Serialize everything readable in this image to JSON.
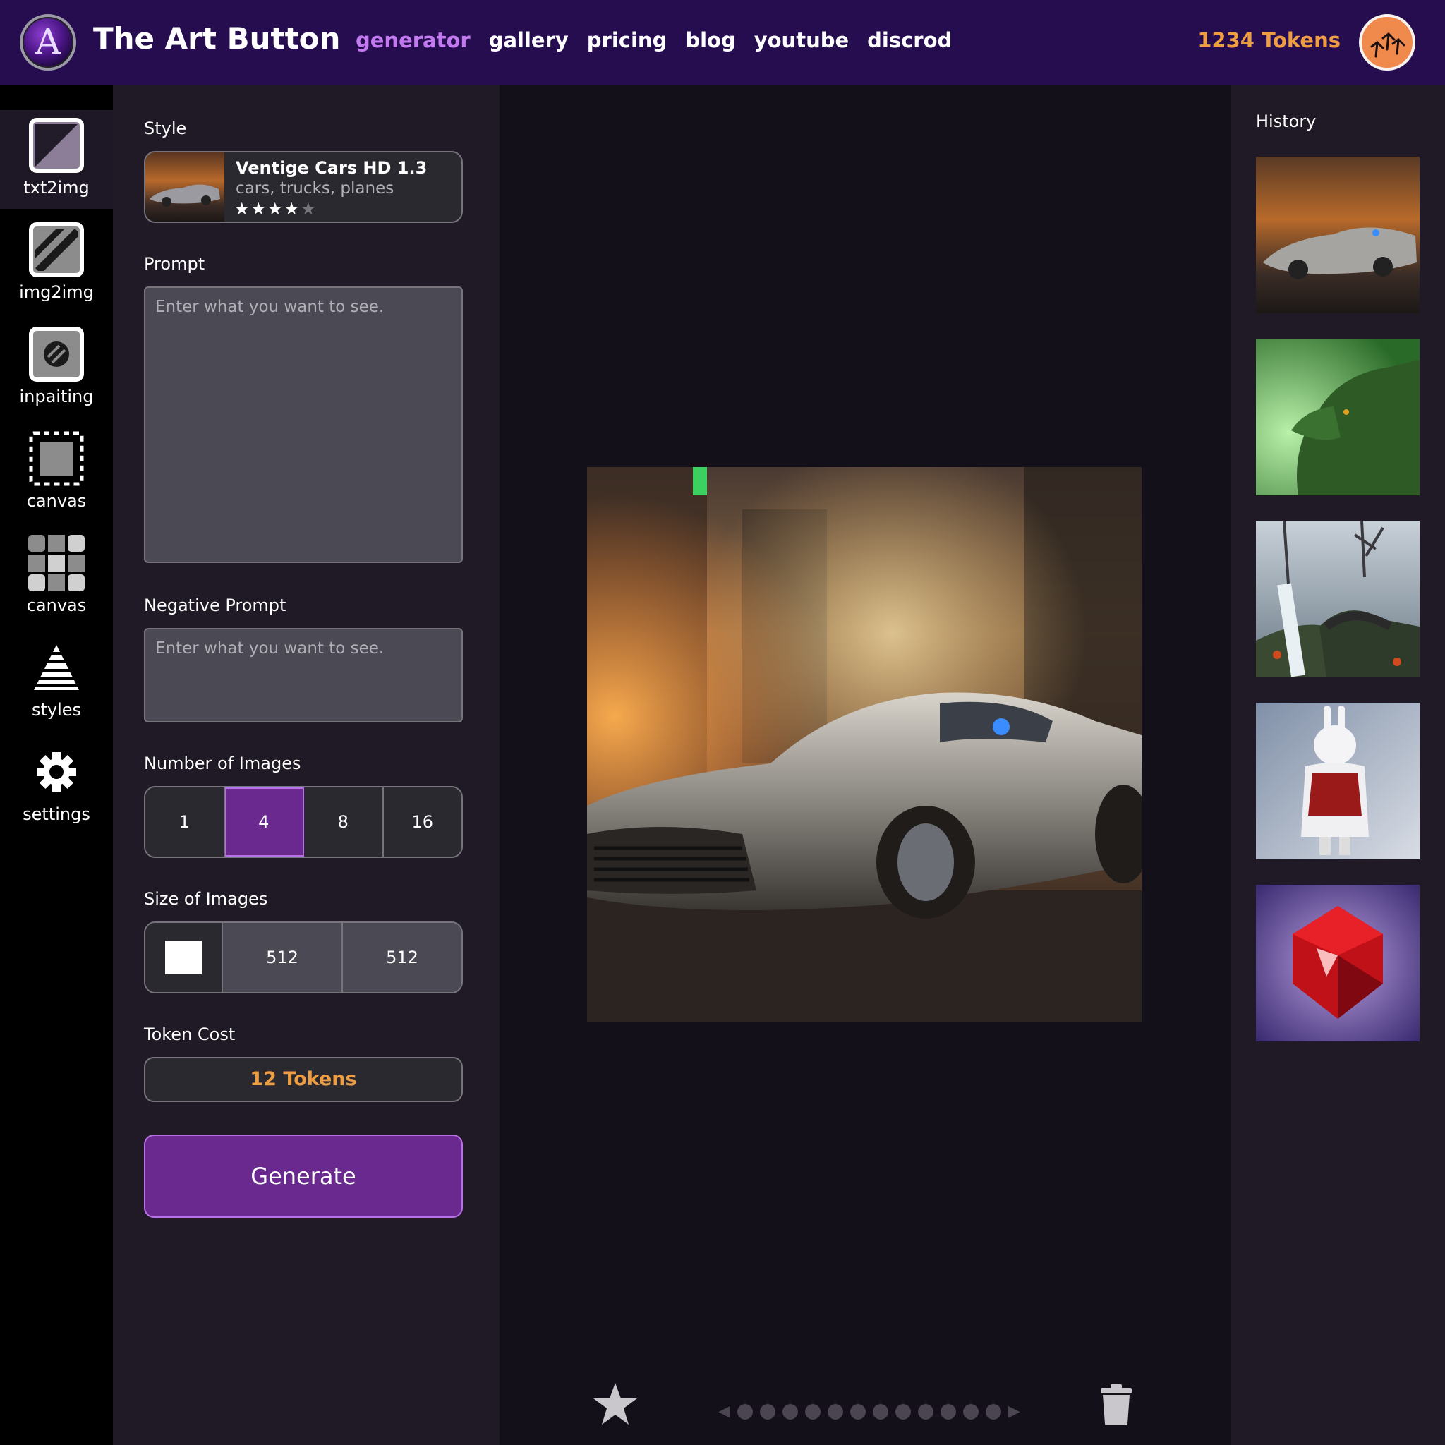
{
  "header": {
    "logo_letter": "A",
    "brand": "The Art Button",
    "nav": [
      {
        "label": "generator",
        "active": true
      },
      {
        "label": "gallery",
        "active": false
      },
      {
        "label": "pricing",
        "active": false
      },
      {
        "label": "blog",
        "active": false
      },
      {
        "label": "youtube",
        "active": false
      },
      {
        "label": "discrod",
        "active": false
      }
    ],
    "tokens": "1234 Tokens",
    "nav_active_color": "#c37af0",
    "tokens_color": "#ef9d43"
  },
  "tools": [
    {
      "label": "txt2img",
      "icon": "txt2img-icon",
      "active": true
    },
    {
      "label": "img2img",
      "icon": "img2img-icon",
      "active": false
    },
    {
      "label": "inpaiting",
      "icon": "inpainting-icon",
      "active": false
    },
    {
      "label": "canvas",
      "icon": "canvas-dashed-icon",
      "active": false
    },
    {
      "label": "canvas",
      "icon": "canvas-grid-icon",
      "active": false
    },
    {
      "label": "styles",
      "icon": "pyramid-icon",
      "active": false
    },
    {
      "label": "settings",
      "icon": "gear-icon",
      "active": false
    }
  ],
  "panel": {
    "style_label": "Style",
    "style": {
      "name": "Ventige Cars HD 1.3",
      "tags": "cars, trucks, planes",
      "stars_on": "★★★★",
      "stars_off": "★",
      "rating": 4
    },
    "prompt_label": "Prompt",
    "prompt_placeholder": "Enter what you want to see.",
    "prompt_value": "",
    "negative_label": "Negative Prompt",
    "negative_placeholder": "Enter what you want to see.",
    "negative_value": "",
    "num_images_label": "Number of Images",
    "num_images_options": [
      "1",
      "4",
      "8",
      "16"
    ],
    "num_images_selected": "4",
    "size_label": "Size of Images",
    "width": "512",
    "height": "512",
    "token_cost_label": "Token Cost",
    "token_cost": "12 Tokens",
    "generate_label": "Generate",
    "accent": "#69298f"
  },
  "viewer": {
    "image_subject": "silver retro car in a glowing city street",
    "page_count": 12
  },
  "history": {
    "title": "History",
    "items": [
      {
        "subject": "silver car in city street"
      },
      {
        "subject": "green mossy lion head"
      },
      {
        "subject": "stone bridge over waterfall in misty forest"
      },
      {
        "subject": "white rabbit warrior in snow"
      },
      {
        "subject": "red gemstone"
      }
    ]
  }
}
